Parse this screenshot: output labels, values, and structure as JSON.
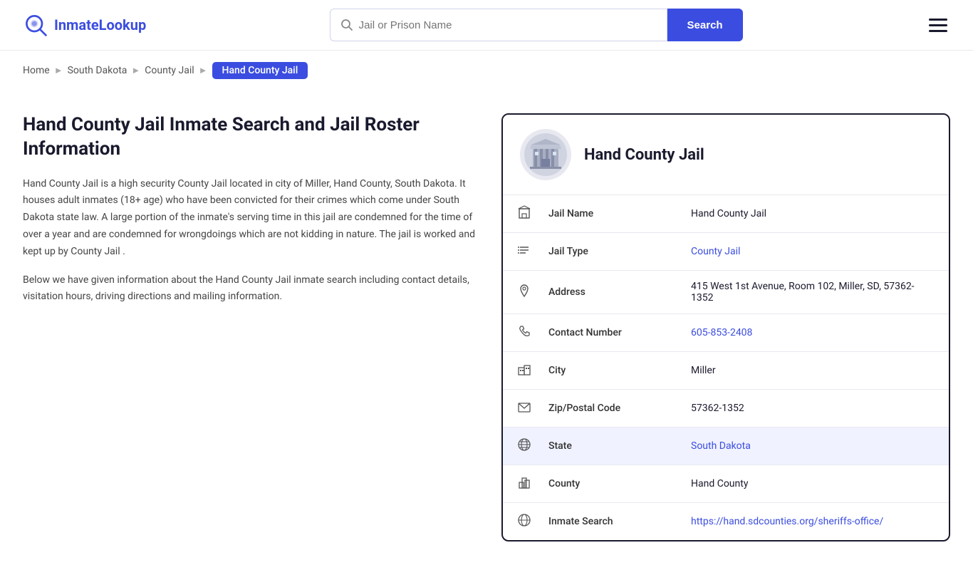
{
  "header": {
    "logo_text_part1": "Inmate",
    "logo_text_part2": "Lookup",
    "search_placeholder": "Jail or Prison Name",
    "search_button_label": "Search"
  },
  "breadcrumb": {
    "home": "Home",
    "state": "South Dakota",
    "type": "County Jail",
    "current": "Hand County Jail"
  },
  "page": {
    "title": "Hand County Jail Inmate Search and Jail Roster Information",
    "description1": "Hand County Jail is a high security County Jail located in city of Miller, Hand County, South Dakota. It houses adult inmates (18+ age) who have been convicted for their crimes which come under South Dakota state law. A large portion of the inmate's serving time in this jail are condemned for the time of over a year and are condemned for wrongdoings which are not kidding in nature. The jail is worked and kept up by County Jail .",
    "description2": "Below we have given information about the Hand County Jail inmate search including contact details, visitation hours, driving directions and mailing information."
  },
  "info_card": {
    "jail_name_heading": "Hand County Jail",
    "rows": [
      {
        "label": "Jail Name",
        "value": "Hand County Jail",
        "link": null,
        "highlighted": false,
        "icon": "building"
      },
      {
        "label": "Jail Type",
        "value": "County Jail",
        "link": "#",
        "highlighted": false,
        "icon": "list"
      },
      {
        "label": "Address",
        "value": "415 West 1st Avenue, Room 102, Miller, SD, 57362-1352",
        "link": null,
        "highlighted": false,
        "icon": "pin"
      },
      {
        "label": "Contact Number",
        "value": "605-853-2408",
        "link": "tel:605-853-2408",
        "highlighted": false,
        "icon": "phone"
      },
      {
        "label": "City",
        "value": "Miller",
        "link": null,
        "highlighted": false,
        "icon": "city"
      },
      {
        "label": "Zip/Postal Code",
        "value": "57362-1352",
        "link": null,
        "highlighted": false,
        "icon": "mail"
      },
      {
        "label": "State",
        "value": "South Dakota",
        "link": "#",
        "highlighted": true,
        "icon": "globe"
      },
      {
        "label": "County",
        "value": "Hand County",
        "link": null,
        "highlighted": false,
        "icon": "county"
      },
      {
        "label": "Inmate Search",
        "value": "https://hand.sdcounties.org/sheriffs-office/",
        "link": "https://hand.sdcounties.org/sheriffs-office/",
        "highlighted": false,
        "icon": "globe2"
      }
    ]
  }
}
